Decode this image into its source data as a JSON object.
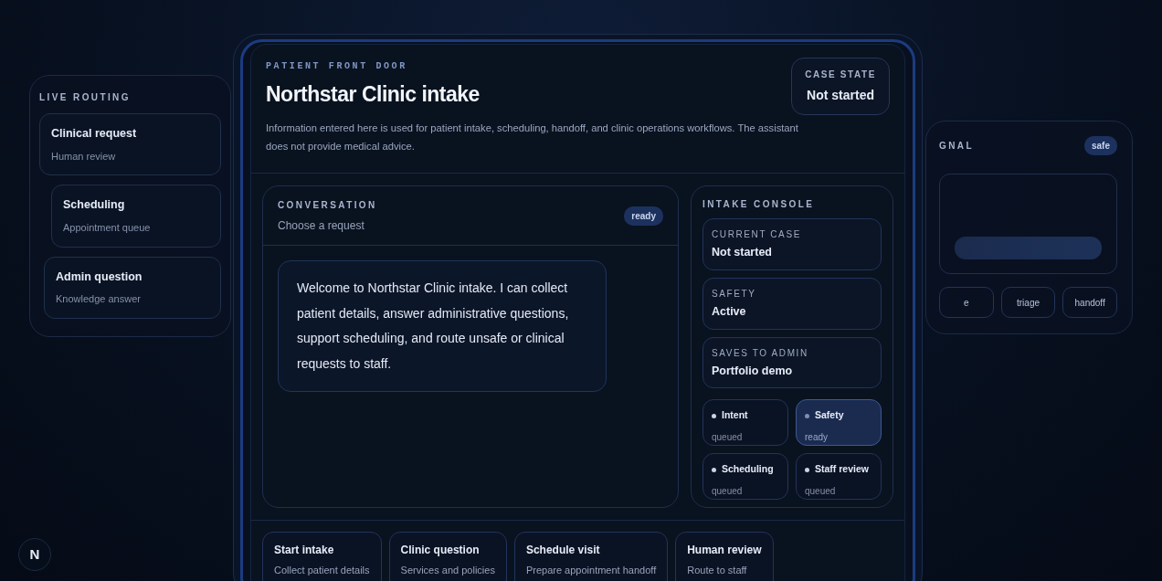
{
  "routing_card": {
    "title": "LIVE ROUTING",
    "items": [
      {
        "title": "Clinical request",
        "subtitle": "Human review"
      },
      {
        "title": "Scheduling",
        "subtitle": "Appointment queue"
      },
      {
        "title": "Admin question",
        "subtitle": "Knowledge answer"
      }
    ]
  },
  "signal_card": {
    "title": "GNAL",
    "badge": "safe",
    "tags": [
      "e",
      "triage",
      "handoff"
    ]
  },
  "intake": {
    "eyebrow": "PATIENT FRONT DOOR",
    "title": "Northstar Clinic intake",
    "case_state": {
      "label": "CASE STATE",
      "value": "Not started"
    },
    "notice": "Information entered here is used for patient intake, scheduling, handoff, and clinic operations workflows. The assistant does not provide medical advice."
  },
  "conversation": {
    "title": "CONVERSATION",
    "subtitle": "Choose a request",
    "badge": "ready",
    "messages": [
      {
        "text": "Welcome to Northstar Clinic intake. I can collect patient details, answer administrative questions, support scheduling, and route unsafe or clinical requests to staff."
      }
    ]
  },
  "console": {
    "title": "INTAKE CONSOLE",
    "fields": [
      {
        "label": "CURRENT CASE",
        "value": "Not started"
      },
      {
        "label": "SAFETY",
        "value": "Active"
      },
      {
        "label": "SAVES TO ADMIN",
        "value": "Portfolio demo"
      }
    ],
    "stages": [
      {
        "name": "Intent",
        "status": "queued",
        "selected": false
      },
      {
        "name": "Safety",
        "status": "ready",
        "selected": true
      },
      {
        "name": "Scheduling",
        "status": "queued",
        "selected": false
      },
      {
        "name": "Staff review",
        "status": "queued",
        "selected": false
      }
    ]
  },
  "actions": [
    {
      "title": "Start intake",
      "subtitle": "Collect patient details"
    },
    {
      "title": "Clinic question",
      "subtitle": "Services and policies"
    },
    {
      "title": "Schedule visit",
      "subtitle": "Prepare appointment handoff"
    },
    {
      "title": "Human review",
      "subtitle": "Route to staff"
    }
  ],
  "logo": {
    "letter": "N"
  }
}
